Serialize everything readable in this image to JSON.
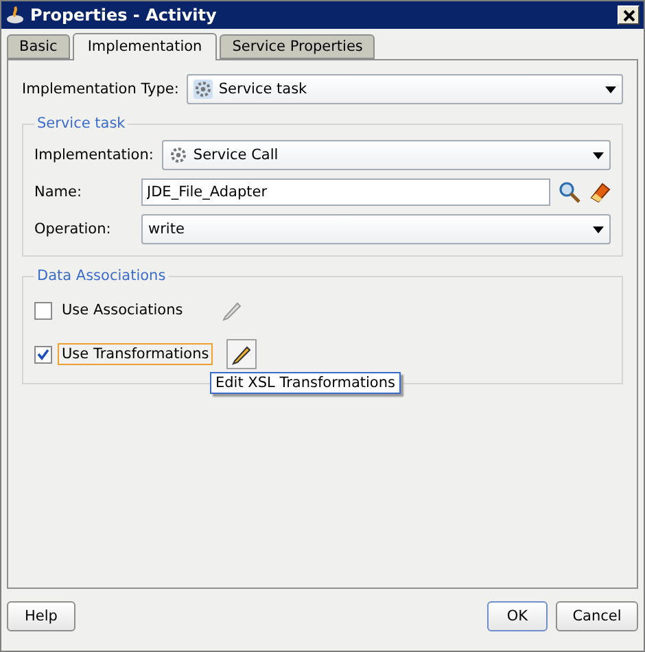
{
  "window": {
    "title": "Properties - Activity"
  },
  "tabs": [
    {
      "label": "Basic",
      "selected": false
    },
    {
      "label": "Implementation",
      "selected": true
    },
    {
      "label": "Service Properties",
      "selected": false
    }
  ],
  "implementation_type": {
    "label": "Implementation Type:",
    "value": "Service task"
  },
  "service_task": {
    "title": "Service task",
    "fields": [
      {
        "kind": "icon_select",
        "label": "Implementation:",
        "value": "Service Call"
      },
      {
        "kind": "text",
        "label": "Name:",
        "value": "JDE_File_Adapter"
      },
      {
        "kind": "select",
        "label": "Operation:",
        "value": "write"
      }
    ]
  },
  "data_associations": {
    "title": "Data Associations",
    "options": [
      {
        "label": "Use Associations",
        "checked": false,
        "focused": false,
        "edit_enabled": false
      },
      {
        "label": "Use Transformations",
        "checked": true,
        "focused": true,
        "edit_enabled": true
      }
    ],
    "tooltip": "Edit XSL Transformations"
  },
  "buttons": [
    {
      "label": "Help",
      "default": false
    },
    {
      "label": "OK",
      "default": true
    },
    {
      "label": "Cancel",
      "default": false
    }
  ]
}
